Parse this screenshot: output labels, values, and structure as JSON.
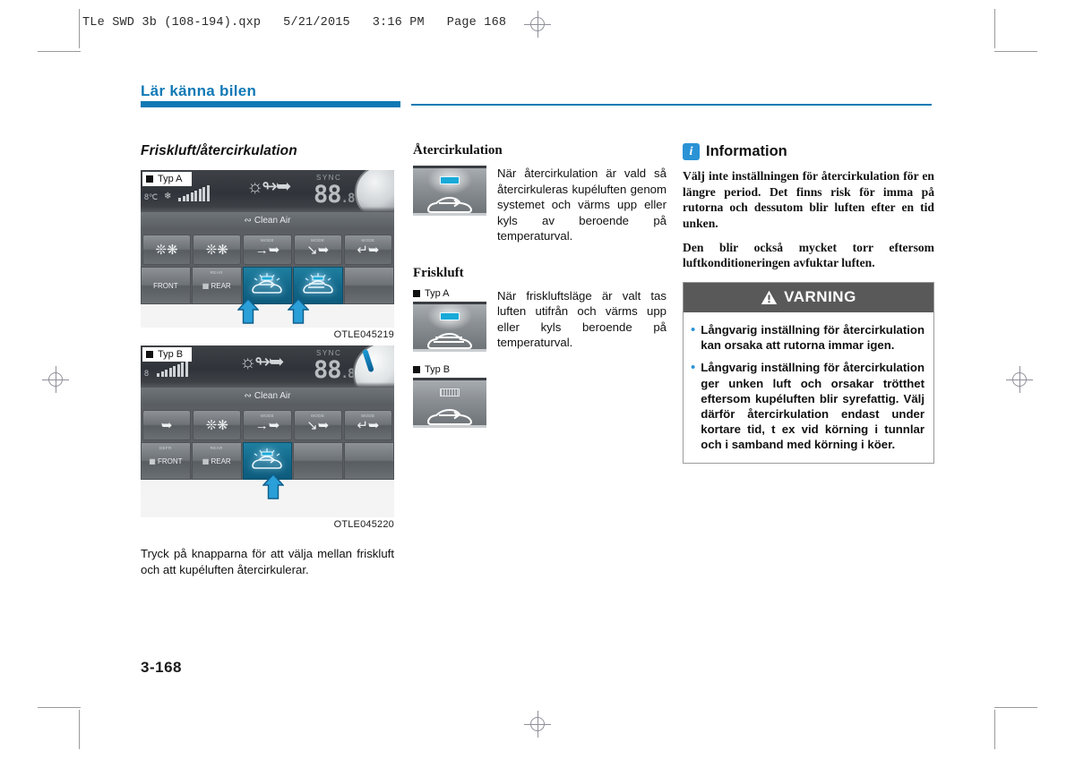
{
  "print_header": "TLe SWD 3b (108-194).qxp   5/21/2015   3:16 PM   Page 168",
  "chapter": {
    "title": "Lär känna bilen",
    "accent_color": "#1079b5"
  },
  "page_number": "3-168",
  "left_column": {
    "heading": "Friskluft/återcirkulation",
    "figures": [
      {
        "badge": "Typ A",
        "code": "OTLE045219",
        "display": {
          "sync": "SYNC",
          "digits": "88",
          "digits_small": ".8",
          "unit": "℃",
          "clean_air": "Clean Air"
        },
        "buttons_row1": [
          "fan-down-icon",
          "fan-up-icon",
          "vent-face-icon",
          "vent-bilevel-icon",
          "vent-floor-icon"
        ],
        "buttons_row2": [
          "defrost-front-button",
          "defrost-rear-button",
          "recirculation-button",
          "fresh-air-button",
          "blank-button"
        ],
        "row2_labels": [
          "FRONT",
          "REAR",
          "",
          "",
          ""
        ],
        "active_buttons": 2,
        "arrow_count": 2
      },
      {
        "badge": "Typ B",
        "code": "OTLE045220",
        "display": {
          "sync": "SYNC",
          "digits": "88",
          "digits_small": ".8",
          "unit": "℃",
          "clean_air": "Clean Air"
        },
        "buttons_row1": [
          "fan-down-icon",
          "fan-up-icon",
          "vent-face-icon",
          "vent-bilevel-icon",
          "vent-floor-icon"
        ],
        "buttons_row2": [
          "defrost-front-button",
          "defrost-rear-button",
          "recirculation-button",
          "blank-button",
          "blank-button"
        ],
        "row2_labels": [
          "FRONT",
          "REAR",
          "",
          "",
          ""
        ],
        "active_buttons": 1,
        "arrow_count": 1
      }
    ],
    "caption": "Tryck på knapparna för att välja mellan friskluft och att kupéluften återcirkulerar."
  },
  "middle_column": {
    "blocks": [
      {
        "heading": "Återcirkulation",
        "typ_label": null,
        "icon": "recirculation-indicator-icon",
        "text": "När återcirkulation är vald så återcirkuleras kupéluften genom systemet och värms upp eller kyls av beroende på temperaturval."
      },
      {
        "heading": "Friskluft",
        "typ_label": "Typ A",
        "icon": "fresh-air-indicator-icon",
        "text": "När friskluftsläge är valt tas luften utifrån och värms upp eller kyls beroende på temperaturval."
      }
    ],
    "typ_b": {
      "typ_label": "Typ B",
      "icon": "fresh-air-indicator-typb-icon"
    }
  },
  "right_column": {
    "info": {
      "icon_letter": "i",
      "title": "Information",
      "icon_color": "#2a93d5",
      "paragraphs": [
        "Välj inte inställningen för återcirkulation för en längre period. Det finns risk för imma på rutorna och dessutom blir luften efter en tid unken.",
        "Den blir också mycket torr eftersom luftkonditioneringen avfuktar luften."
      ]
    },
    "warning": {
      "title": "VARNING",
      "icon": "warning-triangle-icon",
      "header_color": "#595959",
      "bullet_color": "#2a93d5",
      "items": [
        "Långvarig inställning för återcirkulation kan orsaka att rutorna immar igen.",
        "Långvarig inställning för återcirkulation ger unken luft och orsakar trötthet eftersom kupéluften blir syrefattig. Välj därför återcirkulation endast under kortare tid, t ex vid körning i tunnlar och i samband med körning i köer."
      ]
    }
  }
}
